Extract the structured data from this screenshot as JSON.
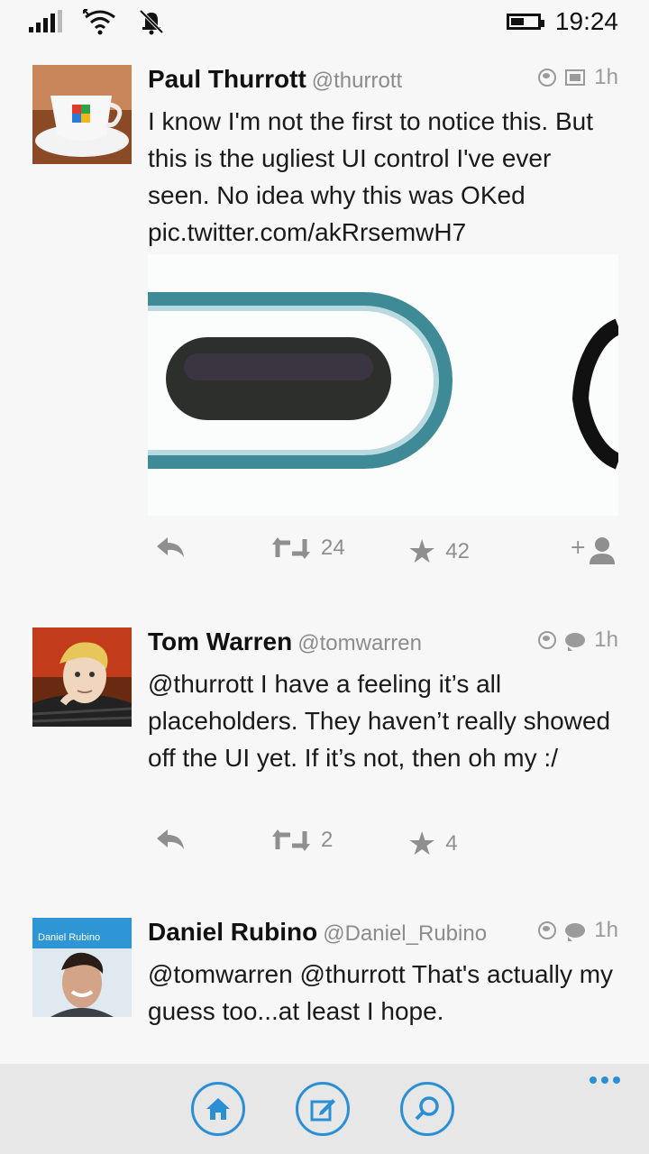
{
  "status": {
    "time": "19:24"
  },
  "tweets": [
    {
      "name": "Paul Thurrott",
      "handle": "@thurrott",
      "time": "1h",
      "text": "I know I'm not the first to notice this. But this is the ugliest UI control I've ever seen. No idea why this was OKed pic.twitter.com/akRrsemwH7",
      "retweets": "24",
      "favorites": "42"
    },
    {
      "name": "Tom Warren",
      "handle": "@tomwarren",
      "time": "1h",
      "text": "@thurrott I have a feeling it’s all placeholders. They haven’t really showed off the UI yet. If it’s not, then oh my :/",
      "retweets": "2",
      "favorites": "4"
    },
    {
      "name": "Daniel Rubino",
      "handle": "@Daniel_Rubino",
      "time": "1h",
      "avatar_label": "Daniel Rubino",
      "text": "@tomwarren @thurrott That's actually my guess too...at least I hope."
    }
  ],
  "appbar": {
    "buttons": [
      "home-icon",
      "compose-icon",
      "search-icon"
    ],
    "accent": "#2b8fd6"
  }
}
